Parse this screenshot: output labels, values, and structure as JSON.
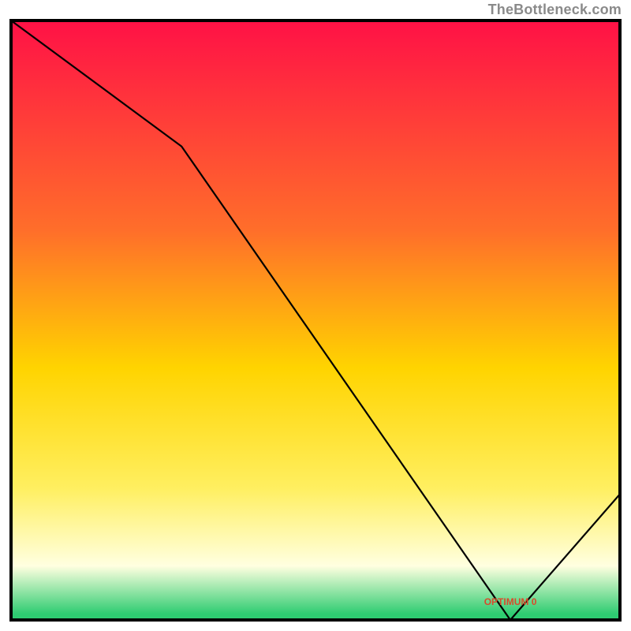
{
  "attribution": "TheBottleneck.com",
  "colors": {
    "top": "#ff1146",
    "mid_upper": "#ff6e2a",
    "mid": "#ffd400",
    "mid_lower": "#ffef60",
    "pale": "#ffffe0",
    "green": "#2ecc71",
    "stroke": "#000000",
    "annotation": "#d84a2b"
  },
  "annotation_label": "OPTIMUM 0",
  "chart_data": {
    "type": "line",
    "title": "",
    "xlabel": "",
    "ylabel": "",
    "xlim": [
      0,
      100
    ],
    "ylim": [
      0,
      100
    ],
    "x": [
      0,
      28,
      82,
      100
    ],
    "values": [
      100,
      79,
      0,
      21
    ],
    "optimal_x": 82,
    "annotations": [
      {
        "x": 82,
        "y": 2.5,
        "text": "OPTIMUM 0"
      }
    ]
  }
}
